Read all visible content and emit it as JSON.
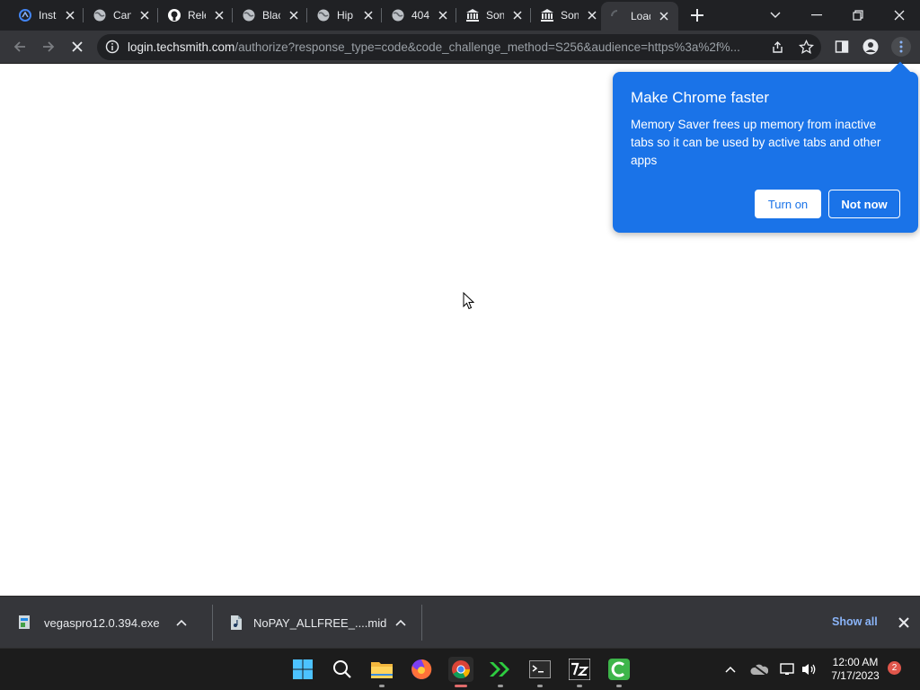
{
  "browser": {
    "tabs": [
      {
        "title": "Insta",
        "icon": "spinner-icon"
      },
      {
        "title": "Can",
        "icon": "globe-icon"
      },
      {
        "title": "Rele",
        "icon": "github-icon"
      },
      {
        "title": "Blac",
        "icon": "globe-icon"
      },
      {
        "title": "Hip",
        "icon": "globe-icon"
      },
      {
        "title": "404",
        "icon": "globe-icon"
      },
      {
        "title": "Son",
        "icon": "bank-icon"
      },
      {
        "title": "Son",
        "icon": "bank-icon"
      },
      {
        "title": "Load",
        "icon": "loading-icon",
        "active": true
      }
    ],
    "omnibox": {
      "host": "login.techsmith.com",
      "path": "/authorize?response_type=code&code_challenge_method=S256&audience=https%3a%2f%..."
    }
  },
  "popup": {
    "title": "Make Chrome faster",
    "body": "Memory Saver frees up memory from inactive tabs so it can be used by active tabs and other apps",
    "turn_on_label": "Turn on",
    "not_now_label": "Not now"
  },
  "downloads": {
    "items": [
      {
        "name": "vegaspro12.0.394.exe"
      },
      {
        "name": "NoPAY_ALLFREE_....mid"
      }
    ],
    "show_all_label": "Show all"
  },
  "taskbar": {
    "time": "12:00 AM",
    "date": "7/17/2023",
    "notification_count": "2"
  },
  "colors": {
    "accent": "#1a73e8",
    "link": "#8ab4f8",
    "tabstrip": "#202124",
    "toolbar": "#35363a"
  }
}
